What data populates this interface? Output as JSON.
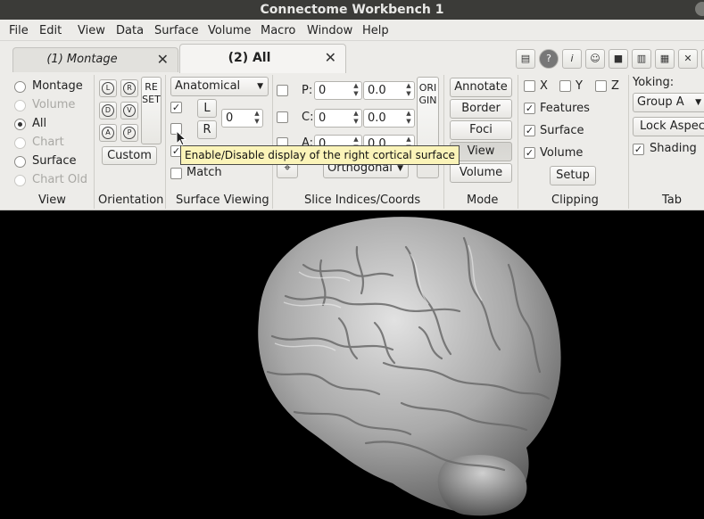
{
  "window": {
    "title": "Connectome Workbench 1"
  },
  "menubar": [
    "File",
    "Edit",
    "View",
    "Data",
    "Surface",
    "Volume",
    "Macro",
    "Window",
    "Help"
  ],
  "tabs": [
    {
      "label": "(1) Montage",
      "active": false
    },
    {
      "label": "(2) All",
      "active": true
    }
  ],
  "toolbar_icons": [
    "info-dialog-icon",
    "help-icon",
    "information-icon",
    "identify-icon",
    "movie-icon",
    "scene-icon",
    "settings-icon",
    "more-icon"
  ],
  "view": {
    "title": "View",
    "options": [
      {
        "label": "Montage",
        "selected": false,
        "enabled": true
      },
      {
        "label": "Volume",
        "selected": false,
        "enabled": false
      },
      {
        "label": "All",
        "selected": true,
        "enabled": true
      },
      {
        "label": "Chart",
        "selected": false,
        "enabled": false
      },
      {
        "label": "Surface",
        "selected": false,
        "enabled": true
      },
      {
        "label": "Chart Old",
        "selected": false,
        "enabled": false
      }
    ]
  },
  "orientation": {
    "title": "Orientation",
    "icons": [
      "L",
      "R",
      "D",
      "V",
      "A",
      "P"
    ],
    "reset_label": "RESET",
    "custom_label": "Custom"
  },
  "surface_viewing": {
    "title": "Surface Viewing",
    "structure": "Anatomical",
    "left_label": "L",
    "right_label": "R",
    "value": "0",
    "match_label": "Match"
  },
  "slice": {
    "title": "Slice Indices/Coords",
    "rows": [
      {
        "axis": "P:",
        "index": "0",
        "coord": "0.0"
      },
      {
        "axis": "C:",
        "index": "0",
        "coord": "0.0"
      },
      {
        "axis": "A:",
        "index": "0",
        "coord": "0.0"
      }
    ],
    "origin_label": "ORIGIN",
    "projection": "Orthogonal"
  },
  "mode": {
    "title": "Mode",
    "buttons": [
      "Annotate",
      "Border",
      "Foci",
      "View",
      "Volume"
    ],
    "active": "View"
  },
  "clipping": {
    "title": "Clipping",
    "axes": [
      {
        "label": "X",
        "checked": false
      },
      {
        "label": "Y",
        "checked": false
      },
      {
        "label": "Z",
        "checked": false
      }
    ],
    "items": [
      {
        "label": "Features",
        "checked": true
      },
      {
        "label": "Surface",
        "checked": true
      },
      {
        "label": "Volume",
        "checked": true
      }
    ],
    "setup_label": "Setup"
  },
  "tab_section": {
    "title": "Tab",
    "yoking_label": "Yoking:",
    "yoking_group": "Group A",
    "lock_aspect_label": "Lock Aspect",
    "shading_label": "Shading",
    "shading_checked": true
  },
  "tooltip": "Enable/Disable display of the right cortical surface",
  "colors": {
    "background": "#000000",
    "panel": "#edece9",
    "titlebar": "#3b3b38",
    "surface": "#bdbdbd"
  }
}
